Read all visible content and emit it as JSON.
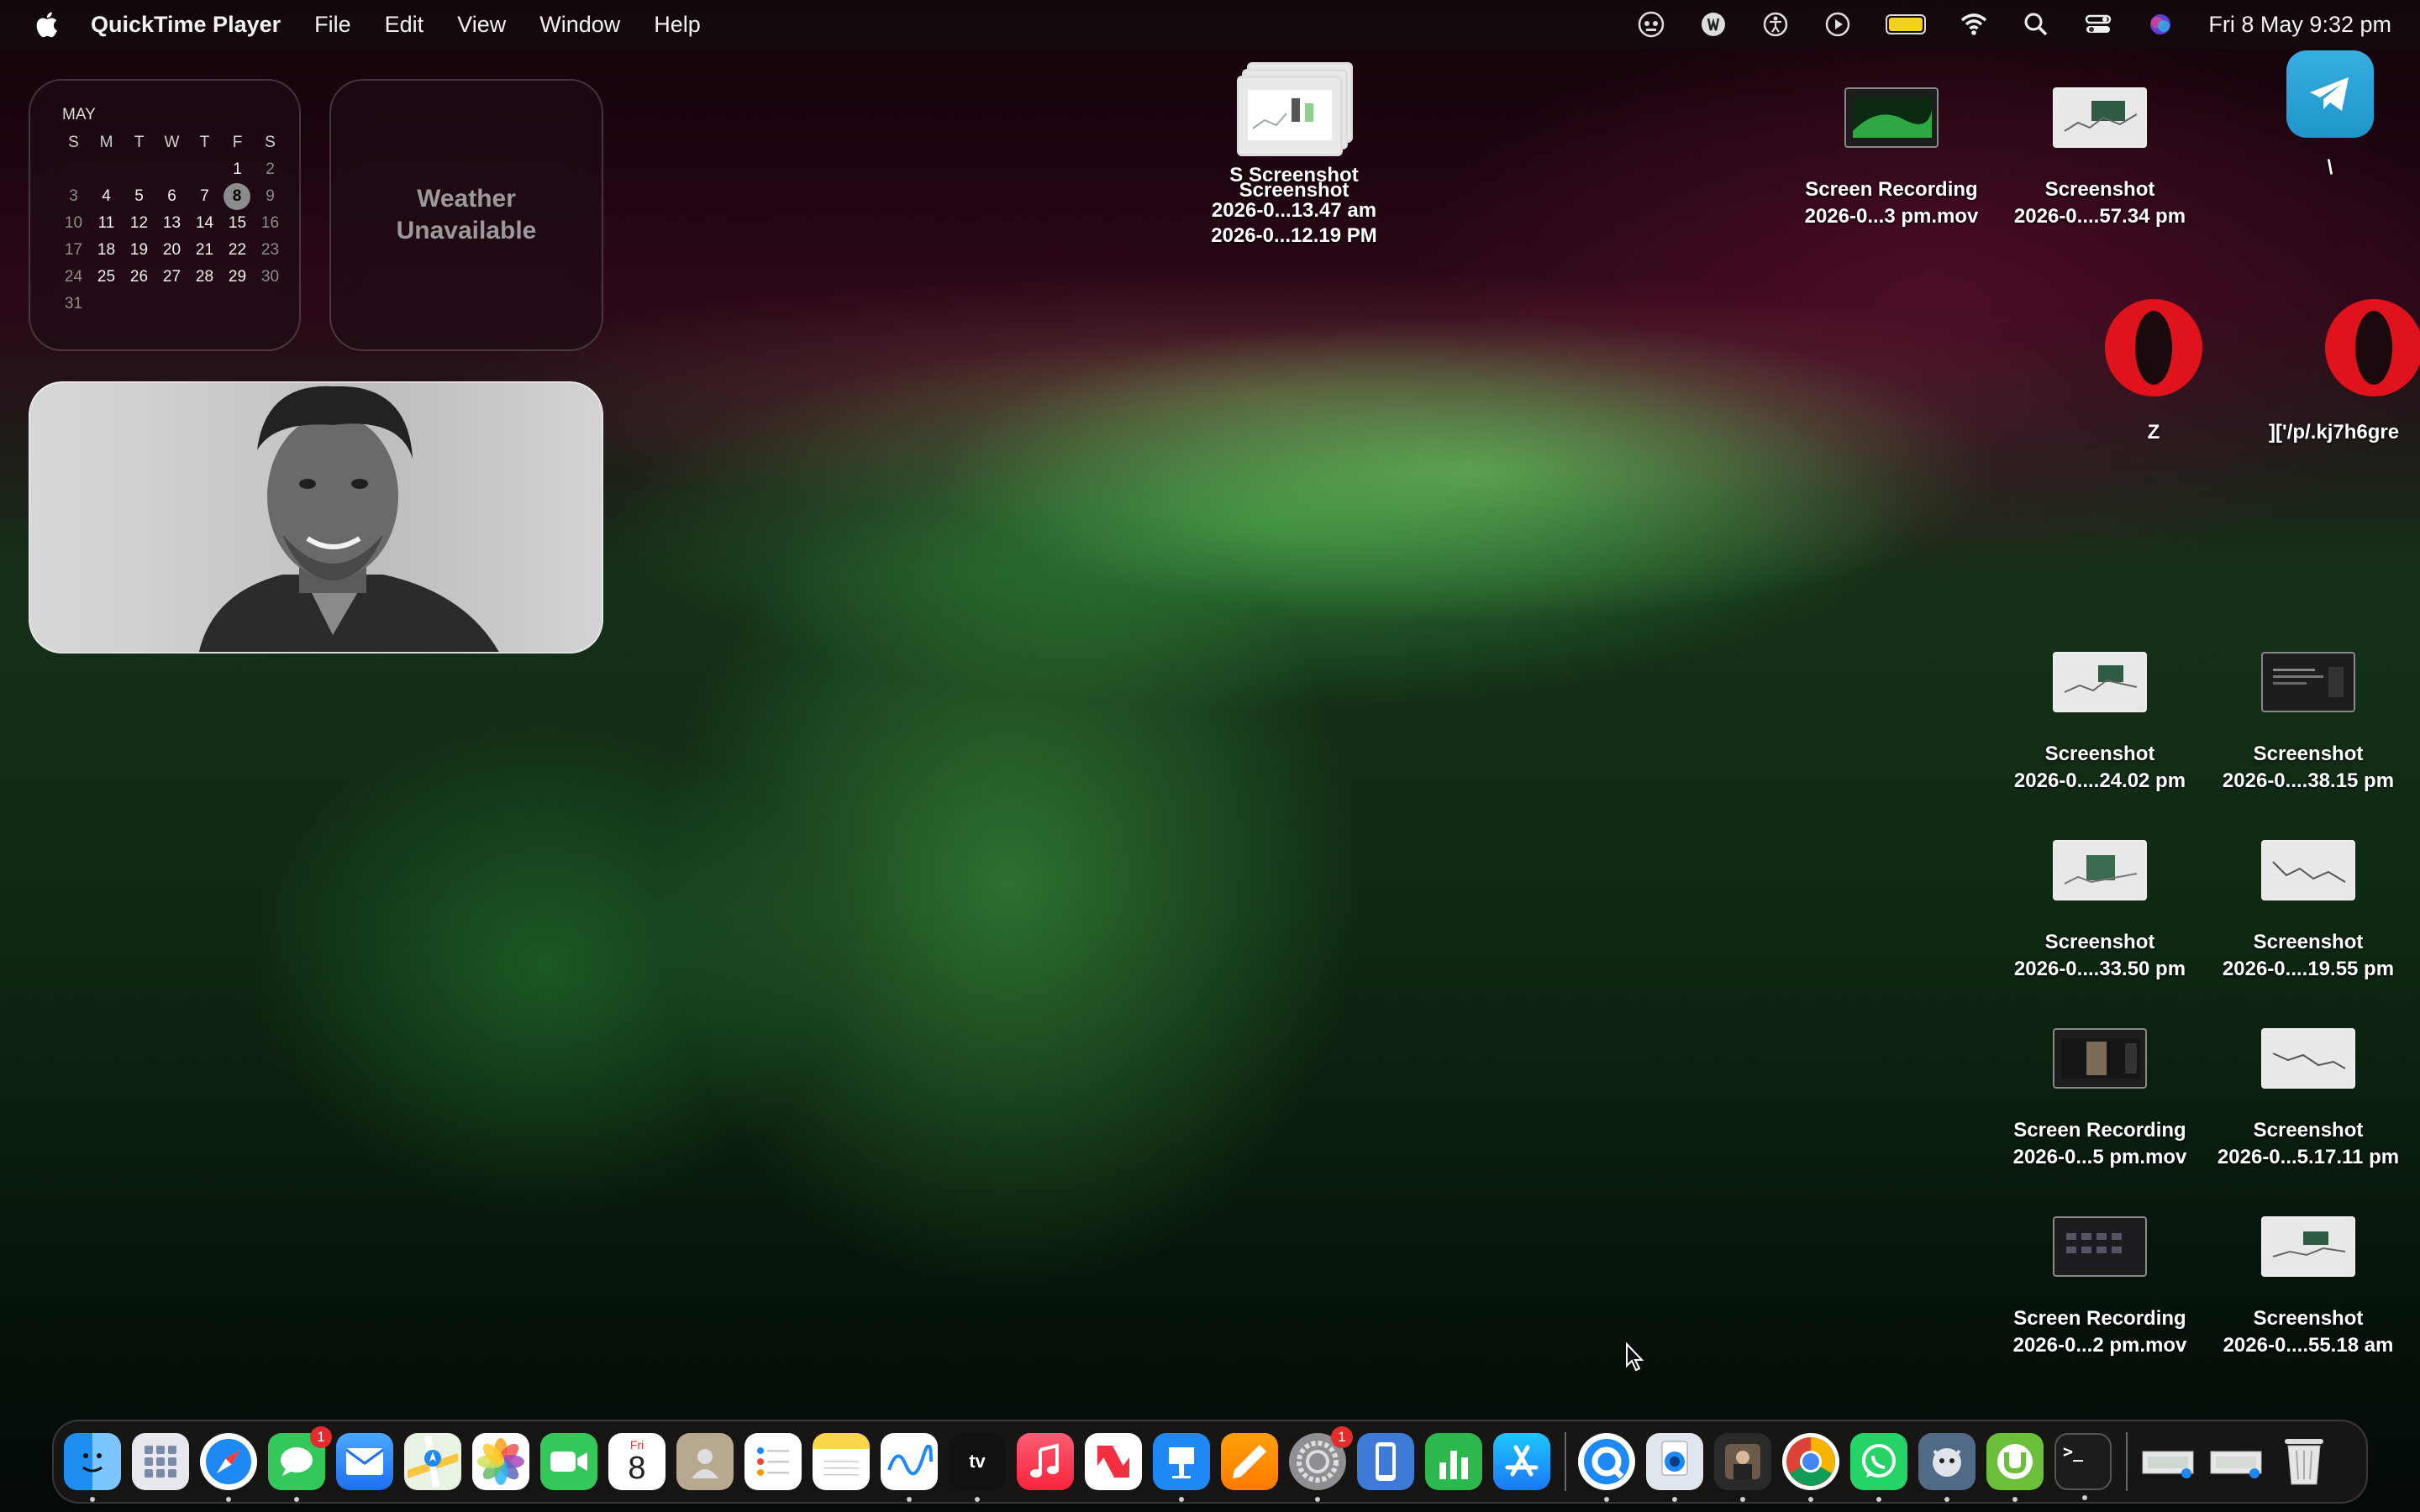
{
  "menubar": {
    "app_name": "QuickTime Player",
    "menus": [
      "File",
      "Edit",
      "View",
      "Window",
      "Help"
    ],
    "status_icons": [
      "robot-icon",
      "vpn-shield-icon",
      "accessibility-icon",
      "play-circle-icon",
      "battery-icon",
      "wifi-icon",
      "spotlight-search-icon",
      "control-center-icon",
      "siri-icon"
    ],
    "battery_color": "#f3d21b",
    "clock": "Fri 8 May  9:32 pm"
  },
  "calendar": {
    "month": "MAY",
    "weekday_headers": [
      "S",
      "M",
      "T",
      "W",
      "T",
      "F",
      "S"
    ],
    "today": "8",
    "weeks": [
      [
        "",
        "",
        "",
        "",
        "",
        "1",
        "2"
      ],
      [
        "3",
        "4",
        "5",
        "6",
        "7",
        "8",
        "9"
      ],
      [
        "10",
        "11",
        "12",
        "13",
        "14",
        "15",
        "16"
      ],
      [
        "17",
        "18",
        "19",
        "20",
        "21",
        "22",
        "23"
      ],
      [
        "24",
        "25",
        "26",
        "27",
        "28",
        "29",
        "30"
      ],
      [
        "31",
        "",
        "",
        "",
        "",
        "",
        ""
      ]
    ]
  },
  "weather": {
    "line1": "Weather",
    "line2": "Unavailable"
  },
  "pile": {
    "labels": [
      "S Screenshot",
      "Screenshot",
      "2026-0...13.47 am",
      "2026-0...12.19 PM"
    ]
  },
  "desktop_icons": {
    "rec_1": {
      "line1": "Screen Recording",
      "line2": "2026-0...3 pm.mov"
    },
    "shot_1": {
      "line1": "Screenshot",
      "line2": "2026-0....57.34 pm"
    },
    "telegram": {
      "label": "\\"
    },
    "opera_1": {
      "label": "Z"
    },
    "opera_2": {
      "label": "]['/p/.kj7h6gre"
    },
    "shot_2": {
      "line1": "Screenshot",
      "line2": "2026-0....24.02 pm"
    },
    "shot_3": {
      "line1": "Screenshot",
      "line2": "2026-0....38.15 pm"
    },
    "shot_4": {
      "line1": "Screenshot",
      "line2": "2026-0....33.50 pm"
    },
    "shot_5": {
      "line1": "Screenshot",
      "line2": "2026-0....19.55 pm"
    },
    "rec_2": {
      "line1": "Screen Recording",
      "line2": "2026-0...5 pm.mov"
    },
    "shot_6": {
      "line1": "Screenshot",
      "line2": "2026-0...5.17.11 pm"
    },
    "rec_3": {
      "line1": "Screen Recording",
      "line2": "2026-0...2 pm.mov"
    },
    "shot_7": {
      "line1": "Screenshot",
      "line2": "2026-0....55.18 am"
    }
  },
  "dock": {
    "calendar_day": "Fri",
    "calendar_date": "8",
    "messages_badge": "1",
    "settings_badge": "1",
    "apps": [
      "finder-icon",
      "launchpad-icon",
      "safari-icon",
      "messages-icon",
      "mail-icon",
      "maps-icon",
      "photos-icon",
      "facetime-icon",
      "calendar-icon",
      "contacts-icon",
      "reminders-icon",
      "notes-icon",
      "freeform-icon",
      "apple-tv-icon",
      "music-icon",
      "news-icon",
      "keynote-icon",
      "pages-icon",
      "system-settings-icon",
      "iphone-mirroring-icon",
      "numbers-icon",
      "app-store-icon",
      "quicktime-icon",
      "preview-icon",
      "photo-app-icon",
      "chrome-icon",
      "whatsapp-icon",
      "utility-app-icon",
      "utorrent-icon",
      "terminal-icon",
      "downloads-stack-icon",
      "documents-stack-icon",
      "trash-icon"
    ]
  }
}
